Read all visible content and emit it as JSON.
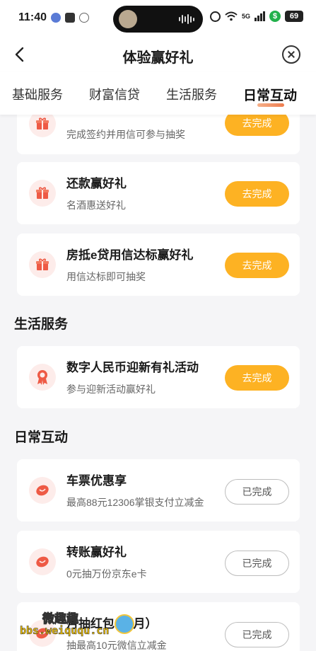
{
  "status": {
    "time": "11:40",
    "network": "5G",
    "battery": "69"
  },
  "nav": {
    "title": "体验赢好礼"
  },
  "tabs": [
    {
      "label": "基础服务"
    },
    {
      "label": "财富信贷"
    },
    {
      "label": "生活服务"
    },
    {
      "label": "日常互动"
    }
  ],
  "cards": [
    {
      "title": "",
      "subtitle": "完成签约并用信可参与抽奖",
      "button": "去完成",
      "icon": "gift-icon"
    },
    {
      "title": "还款赢好礼",
      "subtitle": "名酒惠送好礼",
      "button": "去完成",
      "icon": "gift-icon"
    },
    {
      "title": "房抵e贷用信达标赢好礼",
      "subtitle": "用信达标即可抽奖",
      "button": "去完成",
      "icon": "gift-icon"
    }
  ],
  "sections": {
    "life": {
      "title": "生活服务",
      "cards": [
        {
          "title": "数字人民币迎新有礼活动",
          "subtitle": "参与迎新活动赢好礼",
          "button": "去完成",
          "icon": "medal-icon"
        }
      ]
    },
    "daily": {
      "title": "日常互动",
      "cards": [
        {
          "title": "车票优惠享",
          "subtitle": "最高88元12306掌银支付立减金",
          "button": "已完成",
          "icon": "red-packet-icon"
        },
        {
          "title": "转账赢好礼",
          "subtitle": "0元抽万份京东e卡",
          "button": "已完成",
          "icon": "red-packet-icon"
        },
        {
          "title": "月抽红包（4月）",
          "subtitle": "抽最高10元微信立减金",
          "button": "已完成",
          "icon": "red-packet-icon"
        }
      ]
    }
  },
  "watermark": {
    "line1": "微趣趣",
    "line2": "bbs.weiququ.cn"
  },
  "colors": {
    "accent_button": "#fdb223",
    "icon_bg": "#fdecea",
    "icon_red": "#ee5a45"
  }
}
